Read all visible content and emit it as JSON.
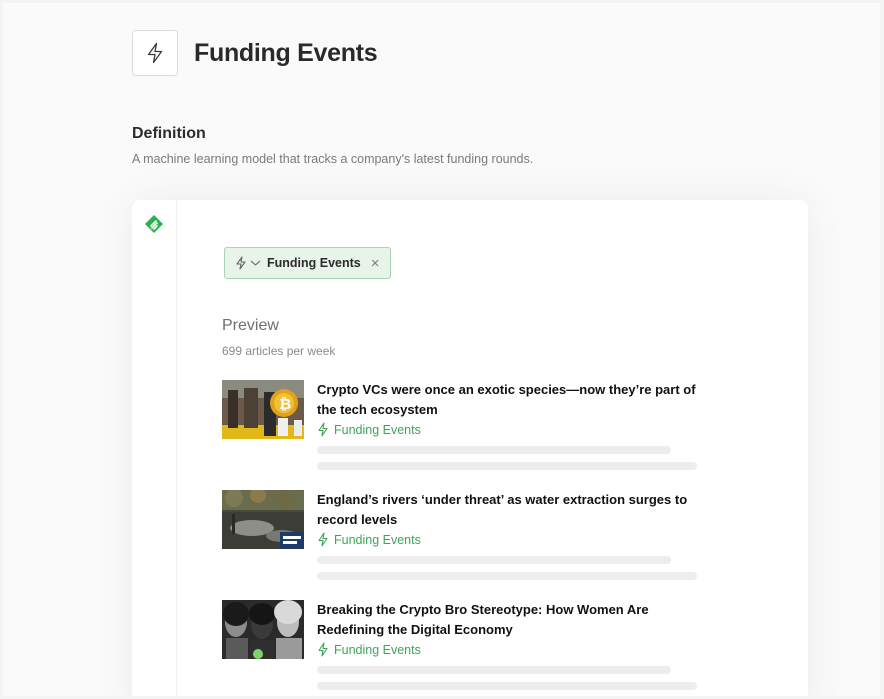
{
  "page": {
    "title": "Funding Events",
    "icon": "lightning-icon"
  },
  "definition": {
    "heading": "Definition",
    "text": "A machine learning model that tracks a company's latest funding rounds."
  },
  "card": {
    "logo": "feedly-logo-icon",
    "chip": {
      "label": "Funding Events",
      "icon": "lightning-icon",
      "dropdown_icon": "chevron-down-icon",
      "close_symbol": "×"
    },
    "preview": {
      "title": "Preview",
      "subtitle": "699 articles per week"
    },
    "articles": [
      {
        "title": "Crypto VCs were once an exotic species—now they’re part of the tech ecosystem",
        "tag": "Funding Events"
      },
      {
        "title": "England’s rivers ‘under threat’ as water extraction surges to record levels",
        "tag": "Funding Events"
      },
      {
        "title": "Breaking the Crypto Bro Stereotype: How Women Are Redefining the Digital Economy",
        "tag": "Funding Events"
      }
    ]
  },
  "colors": {
    "accent": "#3ea557",
    "chip_bg": "#e8f4ea",
    "chip_border": "#a9d3b2"
  }
}
